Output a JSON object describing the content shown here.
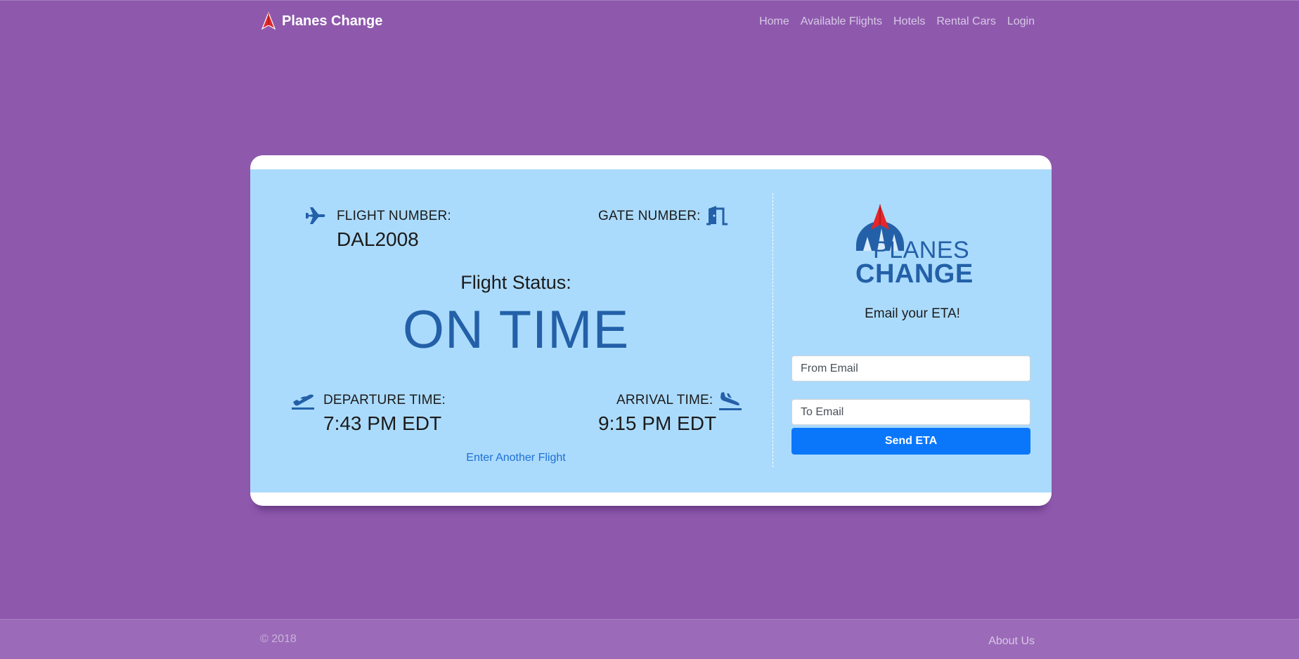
{
  "navbar": {
    "brand": "Planes Change",
    "brand_icon": "paper-plane-icon",
    "links": [
      "Home",
      "Available Flights",
      "Hotels",
      "Rental Cars",
      "Login"
    ]
  },
  "ticket": {
    "flight_number_label": "FLIGHT NUMBER:",
    "flight_number": "DAL2008",
    "flight_icon": "airplane-icon",
    "gate_number_label": "GATE NUMBER:",
    "gate_icon": "door-icon",
    "status_label": "Flight Status:",
    "status": "ON TIME",
    "departure_label": "DEPARTURE TIME:",
    "departure_time": "7:43 PM EDT",
    "departure_icon": "plane-departure-icon",
    "arrival_label": "ARRIVAL TIME:",
    "arrival_time": "9:15 PM EDT",
    "arrival_icon": "plane-arrival-icon",
    "another_flight_link": "Enter Another Flight"
  },
  "email_panel": {
    "logo_line1": "PLANES",
    "logo_line2": "CHANGE",
    "title": "Email your ETA!",
    "from_placeholder": "From Email",
    "to_placeholder": "To Email",
    "send_label": "Send ETA"
  },
  "footer": {
    "copyright": "© 2018",
    "about_link": "About Us"
  },
  "colors": {
    "background": "#8e59ad",
    "ticket": "#abdbfc",
    "accent_blue": "#2360a8",
    "button": "#0a77fb",
    "footer": "#9b6ab8"
  }
}
